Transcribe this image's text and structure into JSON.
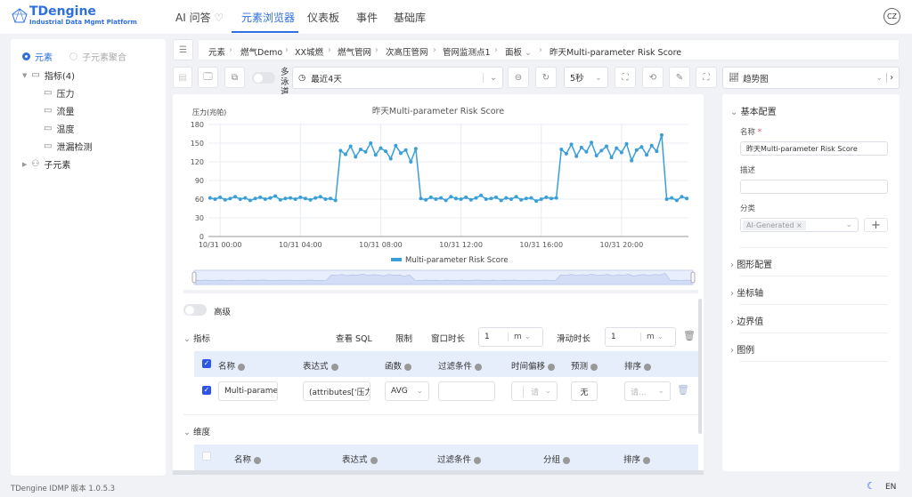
{
  "header": {
    "brand": "TDengine",
    "subtitle": "Industrial Data Mgmt Platform",
    "nav": [
      "AI 问答",
      "元素浏览器",
      "仪表板",
      "事件",
      "基础库"
    ],
    "active": "元素浏览器",
    "avatar": "CZ"
  },
  "left": {
    "radio": [
      "元素",
      "子元素聚合"
    ],
    "metrics_group": "指标(4)",
    "metrics": [
      "压力",
      "流量",
      "温度",
      "泄漏检测"
    ],
    "children_group": "子元素"
  },
  "breadcrumb": [
    "元素",
    "燃气Demo",
    "XX城燃",
    "燃气管网",
    "次高压管网",
    "管网监测点1",
    "面板",
    "昨天Multi-parameter Risk Score"
  ],
  "toolbar": {
    "multi_lane": "多泳道",
    "time_range": "最近4天",
    "refresh": "5秒",
    "chart_type": "趋势图"
  },
  "chart_data": {
    "type": "line",
    "title": "昨天Multi-parameter Risk Score",
    "ylabel": "压力(兆帕)",
    "ylim": [
      0,
      180
    ],
    "yticks": [
      0,
      30,
      60,
      90,
      120,
      150,
      180
    ],
    "xticks": [
      "10/31 00:00",
      "10/31 04:00",
      "10/31 08:00",
      "10/31 12:00",
      "10/31 16:00",
      "10/31 20:00"
    ],
    "xlim": [
      "10/30 23:25",
      "10/31 23:20"
    ],
    "grid": true,
    "legend_position": "bottom",
    "color": "#3a9fd9",
    "series": [
      {
        "name": "Multi-parameter Risk Score",
        "x": [
          "10/30 23:30",
          "10/30 23:45",
          "10/31 00:00",
          "10/31 00:15",
          "10/31 00:30",
          "10/31 00:45",
          "10/31 01:00",
          "10/31 01:15",
          "10/31 01:30",
          "10/31 01:45",
          "10/31 02:00",
          "10/31 02:15",
          "10/31 02:30",
          "10/31 02:45",
          "10/31 03:00",
          "10/31 03:15",
          "10/31 03:30",
          "10/31 03:45",
          "10/31 04:00",
          "10/31 04:15",
          "10/31 04:30",
          "10/31 04:45",
          "10/31 05:00",
          "10/31 05:15",
          "10/31 05:30",
          "10/31 05:45",
          "10/31 06:00",
          "10/31 06:15",
          "10/31 06:30",
          "10/31 06:45",
          "10/31 07:00",
          "10/31 07:15",
          "10/31 07:30",
          "10/31 07:45",
          "10/31 08:00",
          "10/31 08:15",
          "10/31 08:30",
          "10/31 08:45",
          "10/31 09:00",
          "10/31 09:15",
          "10/31 09:30",
          "10/31 09:45",
          "10/31 10:00",
          "10/31 10:15",
          "10/31 10:30",
          "10/31 10:45",
          "10/31 11:00",
          "10/31 11:15",
          "10/31 11:30",
          "10/31 11:45",
          "10/31 12:00",
          "10/31 12:15",
          "10/31 12:30",
          "10/31 12:45",
          "10/31 13:00",
          "10/31 13:15",
          "10/31 13:30",
          "10/31 13:45",
          "10/31 14:00",
          "10/31 14:15",
          "10/31 14:30",
          "10/31 14:45",
          "10/31 15:00",
          "10/31 15:15",
          "10/31 15:30",
          "10/31 15:45",
          "10/31 16:00",
          "10/31 16:15",
          "10/31 16:30",
          "10/31 16:45",
          "10/31 17:00",
          "10/31 17:15",
          "10/31 17:30",
          "10/31 17:45",
          "10/31 18:00",
          "10/31 18:15",
          "10/31 18:30",
          "10/31 18:45",
          "10/31 19:00",
          "10/31 19:15",
          "10/31 19:30",
          "10/31 19:45",
          "10/31 20:00",
          "10/31 20:15",
          "10/31 20:30",
          "10/31 20:45",
          "10/31 21:00",
          "10/31 21:15",
          "10/31 21:30",
          "10/31 21:45",
          "10/31 22:00",
          "10/31 22:15",
          "10/31 22:30",
          "10/31 22:45",
          "10/31 23:00",
          "10/31 23:15"
        ],
        "values": [
          62,
          60,
          63,
          59,
          61,
          64,
          60,
          62,
          58,
          61,
          63,
          60,
          62,
          65,
          59,
          61,
          62,
          60,
          63,
          61,
          59,
          62,
          64,
          60,
          61,
          58,
          138,
          132,
          145,
          128,
          140,
          136,
          150,
          131,
          142,
          137,
          125,
          146,
          134,
          139,
          120,
          141,
          61,
          59,
          63,
          60,
          62,
          58,
          64,
          61,
          60,
          63,
          59,
          62,
          66,
          60,
          61,
          63,
          58,
          62,
          60,
          64,
          59,
          61,
          62,
          57,
          60,
          63,
          61,
          62,
          140,
          133,
          148,
          129,
          143,
          136,
          151,
          130,
          138,
          145,
          127,
          142,
          135,
          149,
          122,
          139,
          144,
          131,
          146,
          137,
          163,
          60,
          62,
          58,
          64,
          61
        ]
      }
    ]
  },
  "query": {
    "advanced": "高级",
    "metrics_section": "指标",
    "view_sql": "查看 SQL",
    "limit": "限制",
    "window_label": "窗口时长",
    "window_value": "1",
    "window_unit": "m",
    "slide_label": "滑动时长",
    "slide_value": "1",
    "slide_unit": "m",
    "columns": [
      "名称",
      "表达式",
      "函数",
      "过滤条件",
      "时间偏移",
      "预测",
      "排序"
    ],
    "row": {
      "name": "Multi-parame",
      "expr": "(attributes['压力",
      "func": "AVG",
      "filter": "",
      "offset_placeholder": "请",
      "forecast": "无",
      "sort_placeholder": "请..."
    },
    "dimension_section": "维度",
    "dim_columns": [
      "名称",
      "表达式",
      "过滤条件",
      "分组",
      "排序"
    ]
  },
  "right": {
    "basic": "基本配置",
    "name_label": "名称",
    "name_value": "昨天Multi-parameter Risk Score",
    "desc_label": "描述",
    "desc_value": "",
    "category_label": "分类",
    "category_tag": "AI-Generated",
    "sections": [
      "图形配置",
      "坐标轴",
      "边界值",
      "图例"
    ]
  },
  "footer": {
    "version": "TDengine IDMP 版本 1.0.5.3",
    "lang": "EN"
  }
}
